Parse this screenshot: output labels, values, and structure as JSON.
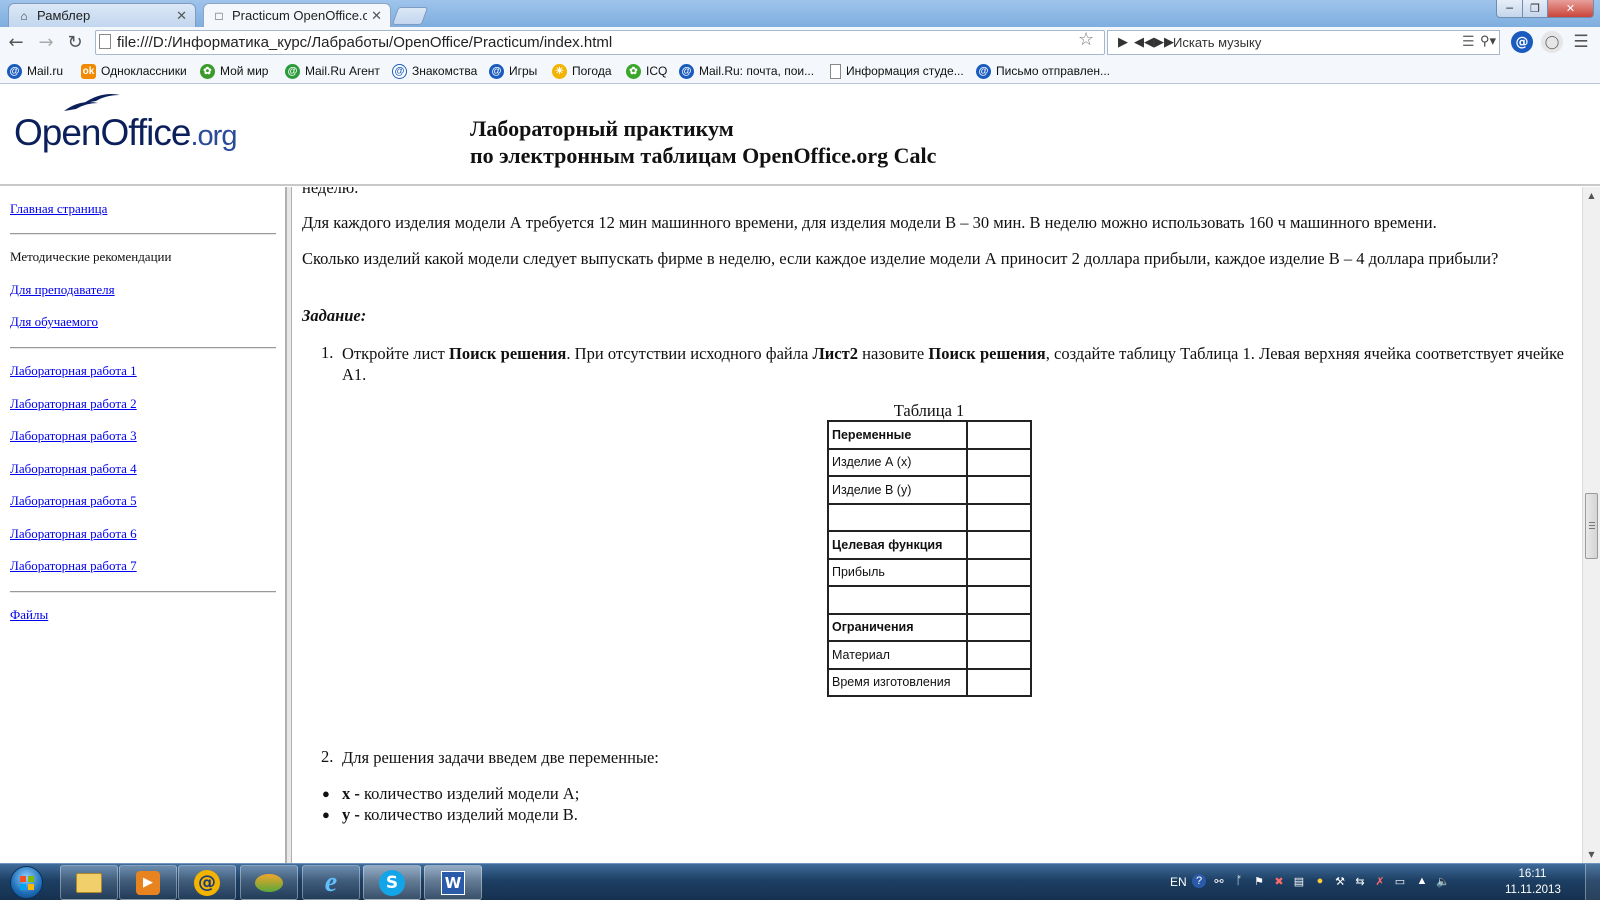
{
  "browser": {
    "tabs": [
      {
        "label": "Рамблер",
        "active": false
      },
      {
        "label": "Practicum OpenOffice.org",
        "active": true
      }
    ],
    "url": "file:///D:/Информатика_курс/Лабработы/OpenOffice/Practicum/index.html",
    "music_search_placeholder": "Искать музыку",
    "bookmarks": [
      {
        "label": "Mail.ru",
        "icon": "mailru-icon",
        "color": "#1a5bbf"
      },
      {
        "label": "Одноклассники",
        "icon": "odnoklassniki-icon",
        "color": "#f28a00"
      },
      {
        "label": "Мой мир",
        "icon": "moimir-icon",
        "color": "#3a9a2a"
      },
      {
        "label": "Mail.Ru Агент",
        "icon": "mailru-agent-icon",
        "color": "#2b9a3a"
      },
      {
        "label": "Знакомства",
        "icon": "at-icon",
        "color": "#1a5bbf"
      },
      {
        "label": "Игры",
        "icon": "games-icon",
        "color": "#1a5bbf"
      },
      {
        "label": "Погода",
        "icon": "weather-icon",
        "color": "#f2b400"
      },
      {
        "label": "ICQ",
        "icon": "icq-icon",
        "color": "#3aa62a"
      },
      {
        "label": "Mail.Ru: почта, пои...",
        "icon": "mailru-icon",
        "color": "#1a5bbf"
      },
      {
        "label": "Информация студе...",
        "icon": "page-icon",
        "color": "#888888"
      },
      {
        "label": "Письмо отправлен...",
        "icon": "mailru-icon",
        "color": "#1a5bbf"
      }
    ]
  },
  "header": {
    "logo_main": "OpenOffice",
    "logo_suffix": ".org",
    "title_line1": "Лабораторный практикум",
    "title_line2": "по электронным таблицам OpenOffice.org Calc"
  },
  "sidebar": {
    "home": "Главная страница",
    "method_heading": "Методические рекомендации",
    "for_teacher": "Для преподавателя",
    "for_student": "Для обучаемого",
    "labs": [
      "Лабораторная работа 1",
      "Лабораторная работа 2",
      "Лабораторная работа 3",
      "Лабораторная работа 4",
      "Лабораторная работа 5",
      "Лабораторная работа 6",
      "Лабораторная работа 7"
    ],
    "files": "Файлы"
  },
  "content": {
    "cut_off_text": "неделю.",
    "p1": "Для каждого изделия модели А требуется 12 мин машинного времени, для изделия модели В – 30 мин. В неделю можно использовать 160 ч машинного времени.",
    "p2": "Сколько изделий какой модели следует выпускать фирме в неделю, если каждое изделие модели А приносит 2 доллара прибыли, каждое изделие В – 4 доллара прибыли?",
    "task_heading": "Задание:",
    "item1": {
      "num": "1.",
      "t1": "Откройте лист ",
      "b1": "Поиск решения",
      "t2": ". При отсутствии исходного файла ",
      "b2": "Лист2",
      "t3": " назовите ",
      "b3": "Поиск решения",
      "t4": ", создайте таблицу Таблица 1. Левая верхняя ячейка соответствует ячейке А1."
    },
    "table_caption": "Таблица 1",
    "table_rows": [
      {
        "label": "Переменные",
        "bold": true
      },
      {
        "label": "Изделие А (x)",
        "bold": false
      },
      {
        "label": "Изделие В (y)",
        "bold": false
      },
      {
        "label": "",
        "bold": false
      },
      {
        "label": "Целевая функция",
        "bold": true
      },
      {
        "label": "Прибыль",
        "bold": false
      },
      {
        "label": "",
        "bold": false
      },
      {
        "label": "Ограничения",
        "bold": true
      },
      {
        "label": "Материал",
        "bold": false
      },
      {
        "label": "Время изготовления",
        "bold": false
      }
    ],
    "item2": {
      "num": "2.",
      "text": "Для решения задачи введем две переменные:"
    },
    "bullets": [
      {
        "var": "x -",
        "text": " количество изделий модели А;"
      },
      {
        "var": "y -",
        "text": " количество изделий модели В."
      }
    ]
  },
  "taskbar": {
    "language": "EN",
    "time": "16:11",
    "date": "11.11.2013"
  }
}
